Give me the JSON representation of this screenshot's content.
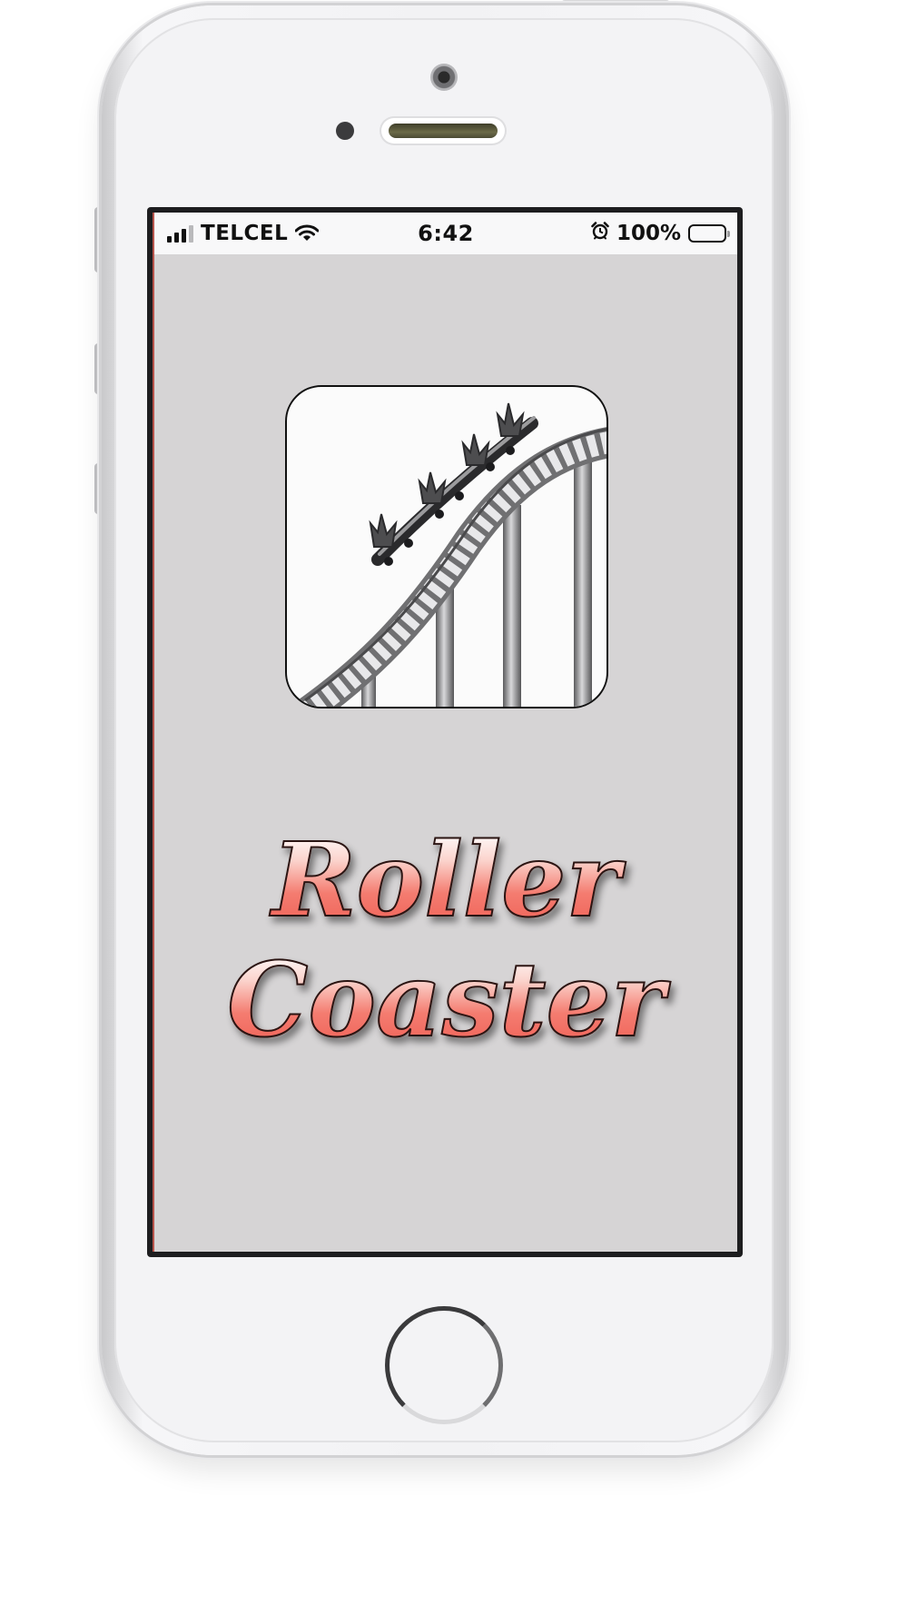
{
  "status_bar": {
    "carrier": "TELCEL",
    "time": "6:42",
    "battery_percent": "100%",
    "icons": [
      "signal-icon",
      "wifi-icon",
      "alarm-icon",
      "battery-icon"
    ]
  },
  "app": {
    "logo_icon": "roller-coaster-icon",
    "title_line1": "Roller",
    "title_line2": "Coaster"
  },
  "colors": {
    "screen_background": "#d6d4d5",
    "title_red": "#f37468",
    "status_bar_background": "#f8f8f9"
  }
}
